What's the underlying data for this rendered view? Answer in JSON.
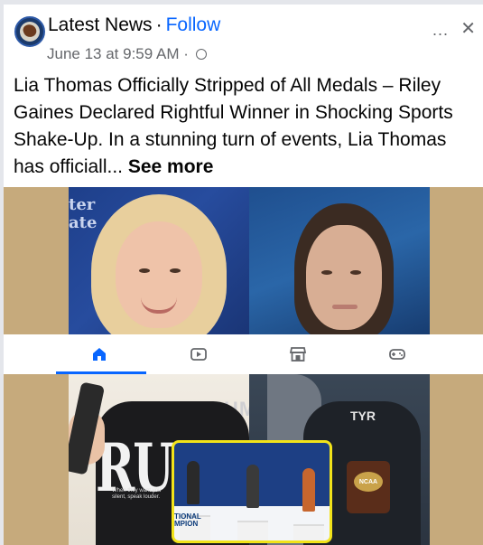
{
  "header": {
    "page_name": "Latest News",
    "separator": "·",
    "follow_label": "Follow",
    "date": "June 13 at 9:59 AM",
    "date_separator": "·",
    "privacy_icon": "globe-icon",
    "more_label": "...",
    "close_label": "✕"
  },
  "post": {
    "text": "Lia Thomas Officially Stripped of All Medals – Riley Gaines Declared Rightful Winner in Shocking Sports Shake-Up. In a stunning turn of events, Lia Thomas has officiall...",
    "see_more_label": "See more"
  },
  "tabs": [
    {
      "name": "home",
      "icon": "home-icon",
      "active": true
    },
    {
      "name": "video",
      "icon": "video-icon",
      "active": false
    },
    {
      "name": "marketplace",
      "icon": "marketplace-icon",
      "active": false
    },
    {
      "name": "gaming",
      "icon": "gaming-icon",
      "active": false
    }
  ],
  "images": {
    "bottom_left_shirt_text": "RUTH",
    "bottom_left_small_text": "When they want you silent, speak louder.",
    "bottom_left_bg_text": "HMA",
    "bottom_right_brand": "TYR",
    "bottom_right_badge": "NCAA",
    "inset_caption": "TIONAL\nMPION",
    "top_left_bg_text": "ter\nate"
  },
  "colors": {
    "accent": "#0866ff",
    "image_background": "#c6aa7c",
    "inset_border": "#f2e31a"
  }
}
